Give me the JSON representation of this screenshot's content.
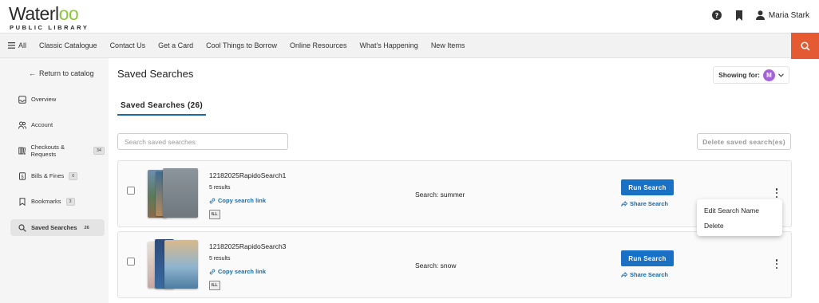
{
  "header": {
    "logo_main": "Waterl",
    "logo_oo": "oo",
    "logo_sub": "PUBLIC LIBRARY",
    "help_icon": "question-circle-icon",
    "bookmark_icon": "bookmark-icon",
    "user_icon": "user-icon",
    "user_name": "Maria Stark"
  },
  "nav": {
    "all_label": "All",
    "items": [
      "Classic Catalogue",
      "Contact Us",
      "Get a Card",
      "Cool Things to Borrow",
      "Online Resources",
      "What's Happening",
      "New Items"
    ],
    "search_icon": "search-icon",
    "accent": "#e35a33"
  },
  "sidebar": {
    "return_label": "Return to catalog",
    "items": [
      {
        "label": "Overview",
        "badge": null,
        "icon": "inbox-icon"
      },
      {
        "label": "Account",
        "badge": null,
        "icon": "users-icon"
      },
      {
        "label": "Checkouts & Requests",
        "badge": "34",
        "icon": "books-icon"
      },
      {
        "label": "Bills & Fines",
        "badge": "0",
        "icon": "bill-icon"
      },
      {
        "label": "Bookmarks",
        "badge": "3",
        "icon": "bookmark-outline-icon"
      },
      {
        "label": "Saved Searches",
        "badge": "26",
        "icon": "search-icon",
        "active": true
      }
    ]
  },
  "main": {
    "title": "Saved Searches",
    "showing_label": "Showing for:",
    "showing_avatar": "M",
    "tab_label": "Saved Searches (26)",
    "search_placeholder": "Search saved searches",
    "delete_label": "Delete saved search(es)",
    "searches": [
      {
        "name": "12182025RapidoSearch1",
        "results": "5 results",
        "copy_label": "Copy search link",
        "ill": "ILL",
        "query": "Search: summer",
        "run_label": "Run Search",
        "share_label": "Share Search"
      },
      {
        "name": "12182025RapidoSearch3",
        "results": "5 results",
        "copy_label": "Copy search link",
        "ill": "ILL",
        "query": "Search: snow",
        "run_label": "Run Search",
        "share_label": "Share Search"
      }
    ],
    "menu": {
      "edit_label": "Edit Search Name",
      "delete_label": "Delete"
    },
    "primary_color": "#1a70c2"
  }
}
